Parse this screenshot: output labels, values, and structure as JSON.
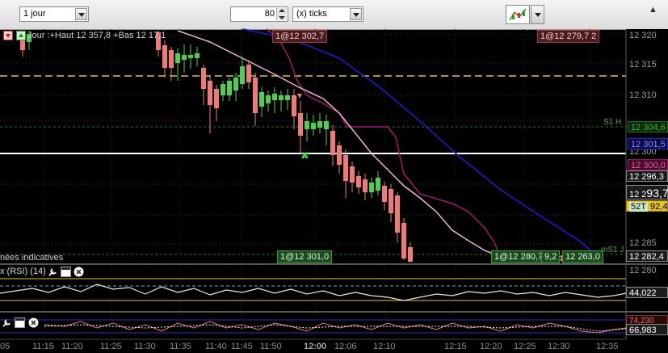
{
  "toolbar": {
    "period_value": "1 jour",
    "ticks_value": "80",
    "ticks_unit": "(x) ticks"
  },
  "chart": {
    "info": "Jour :+Haut 12 357,8 +Bas 12 1",
    "info_tail": "7,1",
    "disclaimer": "nées indicatives",
    "order_tags": {
      "top_mid": "1@12 302,7",
      "top_right": "1@12 279,7",
      "top_right_tail": "2",
      "bottom_left": "1@12 301,0",
      "bottom_right": "1@12 280,7",
      "bottom_right2": "9,2",
      "bottom_right3": "12 263,0"
    },
    "line_labels": {
      "s1": "S1 H",
      "ms1": "mS1 J"
    },
    "price_axis": [
      "12 320",
      "12 315",
      "12 310",
      "12 305",
      "12 300",
      "12 285",
      "12 280"
    ],
    "price_tags": {
      "t1": "12 304,6",
      "t2": "12 301,5",
      "t3": "12 300,0",
      "t4": "12 296,3",
      "t5": "12 293,7",
      "t5_big": "93,7",
      "t5_prefix": "12 2",
      "t6_prefix": "52T",
      "t6": "92,4",
      "t7": "12 282,4"
    }
  },
  "rsi_panel": {
    "title": "x (RSI) (14)",
    "value": "44,022"
  },
  "stoch_panel": {
    "value": "66,983",
    "value2": "74,230"
  },
  "time_axis": [
    "05",
    "11:15",
    "11:20",
    "11:25",
    "11:30",
    "11:35",
    "11:40",
    "11:45",
    "11:50",
    "12:00",
    "12:06",
    "12:10",
    "12:15",
    "12:20",
    "12:25",
    "12:30",
    "12:35"
  ],
  "colors": {
    "bull": "#4ecf4e",
    "bear": "#f07a7a",
    "pivot_yellow": "#e6c229",
    "ma_pink": "#e8b5d6",
    "ma_blue": "#1a1ab5",
    "ma_purple": "#a0186a"
  }
}
